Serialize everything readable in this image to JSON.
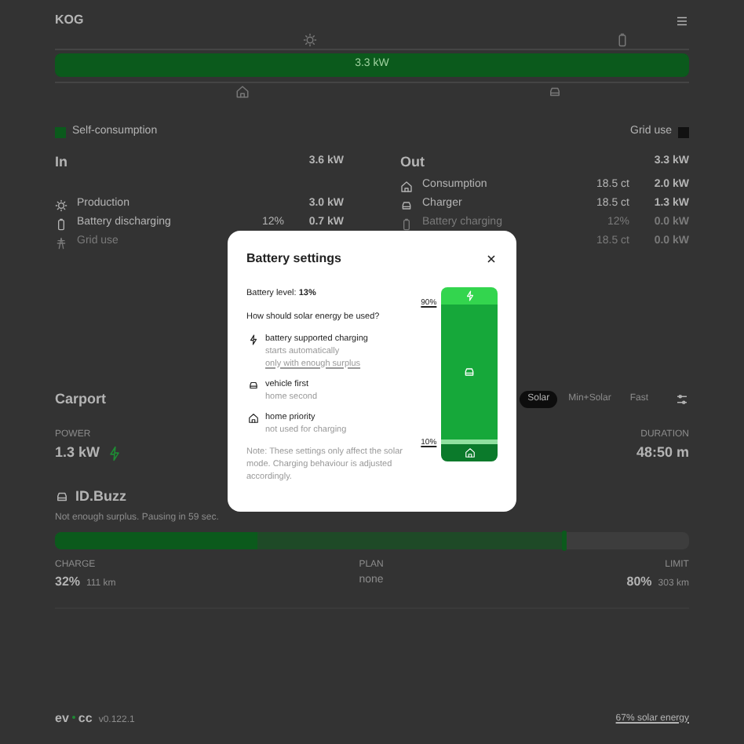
{
  "header": {
    "title": "KOG"
  },
  "energyflow": {
    "bar_label": "3.3 kW",
    "legend": [
      {
        "label": "Self-consumption",
        "color": "#0b5a1c"
      },
      {
        "label": "Grid use",
        "color": "#111111"
      }
    ]
  },
  "in": {
    "title": "In",
    "total": "3.6 kW",
    "rows": [
      {
        "kind": "sun",
        "label": "Production",
        "value": "3.0 kW",
        "disabled": false
      },
      {
        "kind": "battery",
        "label": "Battery discharging",
        "extra": "12%",
        "value": "0.7 kW",
        "disabled": false
      },
      {
        "kind": "grid",
        "label": "Grid use",
        "disabled": true
      }
    ]
  },
  "out": {
    "title": "Out",
    "total": "3.3 kW",
    "rows": [
      {
        "kind": "home",
        "label": "Consumption",
        "extra": "18.5 ct",
        "value": "2.0 kW",
        "disabled": false
      },
      {
        "kind": "car",
        "label": "Charger",
        "extra": "18.5 ct",
        "value": "1.3 kW",
        "disabled": false
      },
      {
        "kind": "battery",
        "label": "Battery charging",
        "extra": "12%",
        "value": "0.0 kW",
        "disabled": true
      },
      {
        "kind": "blank",
        "extra": "18.5 ct",
        "value": "0.0 kW",
        "disabled": true
      }
    ]
  },
  "loadpoint": {
    "title": "Carport",
    "modes": [
      {
        "label": "Solar",
        "selected": true
      },
      {
        "label": "Min+Solar",
        "selected": false
      },
      {
        "label": "Fast",
        "selected": false
      }
    ],
    "power_label": "POWER",
    "power": "1.3 kW",
    "duration_label": "DURATION",
    "duration": "48:50 m",
    "vehicle": "ID.Buzz",
    "status": "Not enough surplus. Pausing in 59 sec.",
    "level": 0.32,
    "limit_slider": {
      "level": 0.8
    },
    "charge_label": "CHARGE",
    "charge": "32%",
    "charge_range": "111 km",
    "plan_label": "PLAN",
    "plan": "none",
    "limit_label": "LIMIT",
    "limit": "80%",
    "limit_range": "303 km"
  },
  "footer": {
    "logo_left": "ev",
    "logo_right": "cc",
    "version": "v0.122.1",
    "solar": "67% solar energy"
  },
  "modal": {
    "title": "Battery settings",
    "battery_level": "Battery level: **13%**",
    "question": "How should solar energy be used?",
    "options": [
      {
        "kind": "bolt",
        "title": "battery supported charging",
        "sub": "starts automatically",
        "link": "only with enough surplus"
      },
      {
        "kind": "car",
        "title": "vehicle first",
        "sub": "home second"
      },
      {
        "kind": "home",
        "title": "home priority",
        "sub": "not used for charging"
      }
    ],
    "note": "Note: These settings only affect the solar mode. Charging behaviour is adjusted accordingly.",
    "upper_label": "90%",
    "lower_label": "10%",
    "level": 0.13
  }
}
